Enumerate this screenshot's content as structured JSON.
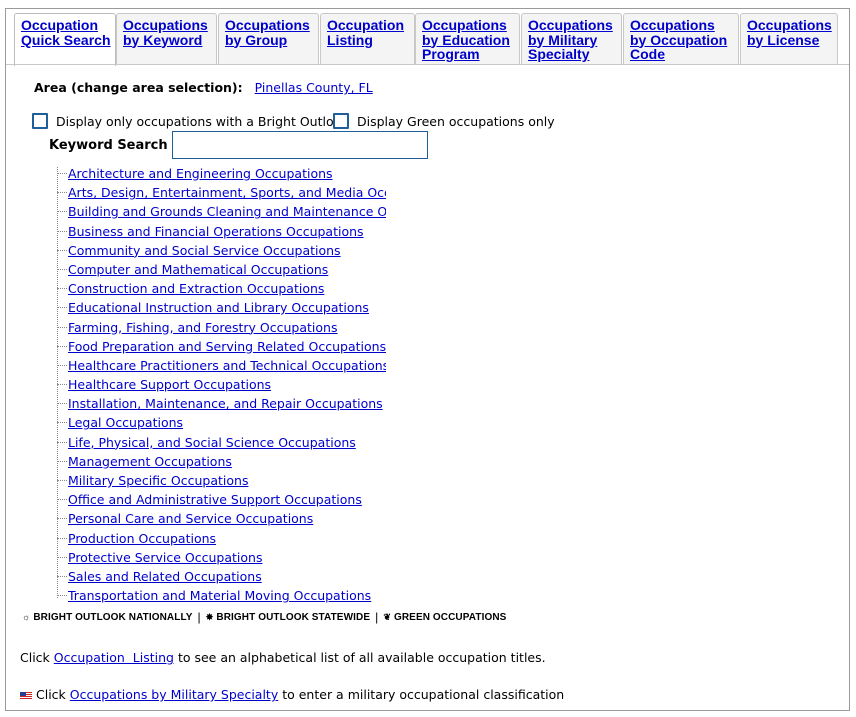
{
  "tabs": [
    {
      "label": "Occupation\nQuick Search",
      "active": true
    },
    {
      "label": "Occupations\nby Keyword",
      "active": false
    },
    {
      "label": "Occupations\nby Group",
      "active": false
    },
    {
      "label": "Occupation\nListing",
      "active": false
    },
    {
      "label": "Occupations\nby Education\nProgram",
      "active": false
    },
    {
      "label": "Occupations\nby Military\nSpecialty",
      "active": false
    },
    {
      "label": "Occupations\nby Occupation\nCode",
      "active": false
    },
    {
      "label": "Occupations\nby License",
      "active": false
    }
  ],
  "area": {
    "label": "Area (change area selection):",
    "value": "Pinellas County, FL"
  },
  "filters": {
    "bright_outlook": "Display only occupations with a Bright Outlook",
    "green": "Display Green occupations only"
  },
  "keyword": {
    "label": "Keyword Search",
    "value": ""
  },
  "groups": [
    "Architecture and Engineering Occupations",
    "Arts, Design, Entertainment, Sports, and Media Occ",
    "Building and Grounds Cleaning and Maintenance Occu",
    "Business and Financial Operations Occupations",
    "Community and Social Service Occupations",
    "Computer and Mathematical Occupations",
    "Construction and Extraction Occupations",
    "Educational Instruction and Library Occupations",
    "Farming, Fishing, and Forestry Occupations",
    "Food Preparation and Serving Related Occupations",
    "Healthcare Practitioners and Technical Occupations",
    "Healthcare Support Occupations",
    "Installation, Maintenance, and Repair Occupations",
    "Legal Occupations",
    "Life, Physical, and Social Science Occupations",
    "Management Occupations",
    "Military Specific Occupations",
    "Office and Administrative Support Occupations",
    "Personal Care and Service Occupations",
    "Production Occupations",
    "Protective Service Occupations",
    "Sales and Related Occupations",
    "Transportation and Material Moving Occupations"
  ],
  "legend": {
    "national": "BRIGHT OUTLOOK NATIONALLY",
    "statewide": "BRIGHT OUTLOOK STATEWIDE",
    "green": "GREEN OCCUPATIONS",
    "national_icon": "sun-icon",
    "statewide_icon": "star-icon",
    "green_icon": "leaf-icon"
  },
  "notes": {
    "listing_prefix": "Click",
    "listing_link": "Occupation  Listing",
    "listing_suffix": "to see an alphabetical list of all available occupation titles.",
    "military_prefix": "Click",
    "military_link": "Occupations by Military Specialty",
    "military_suffix": "to enter a military occupational classification",
    "military_icon": "us-flag-icon"
  },
  "colors": {
    "link": "#0000cc",
    "checkbox_border": "#1f5f99"
  }
}
